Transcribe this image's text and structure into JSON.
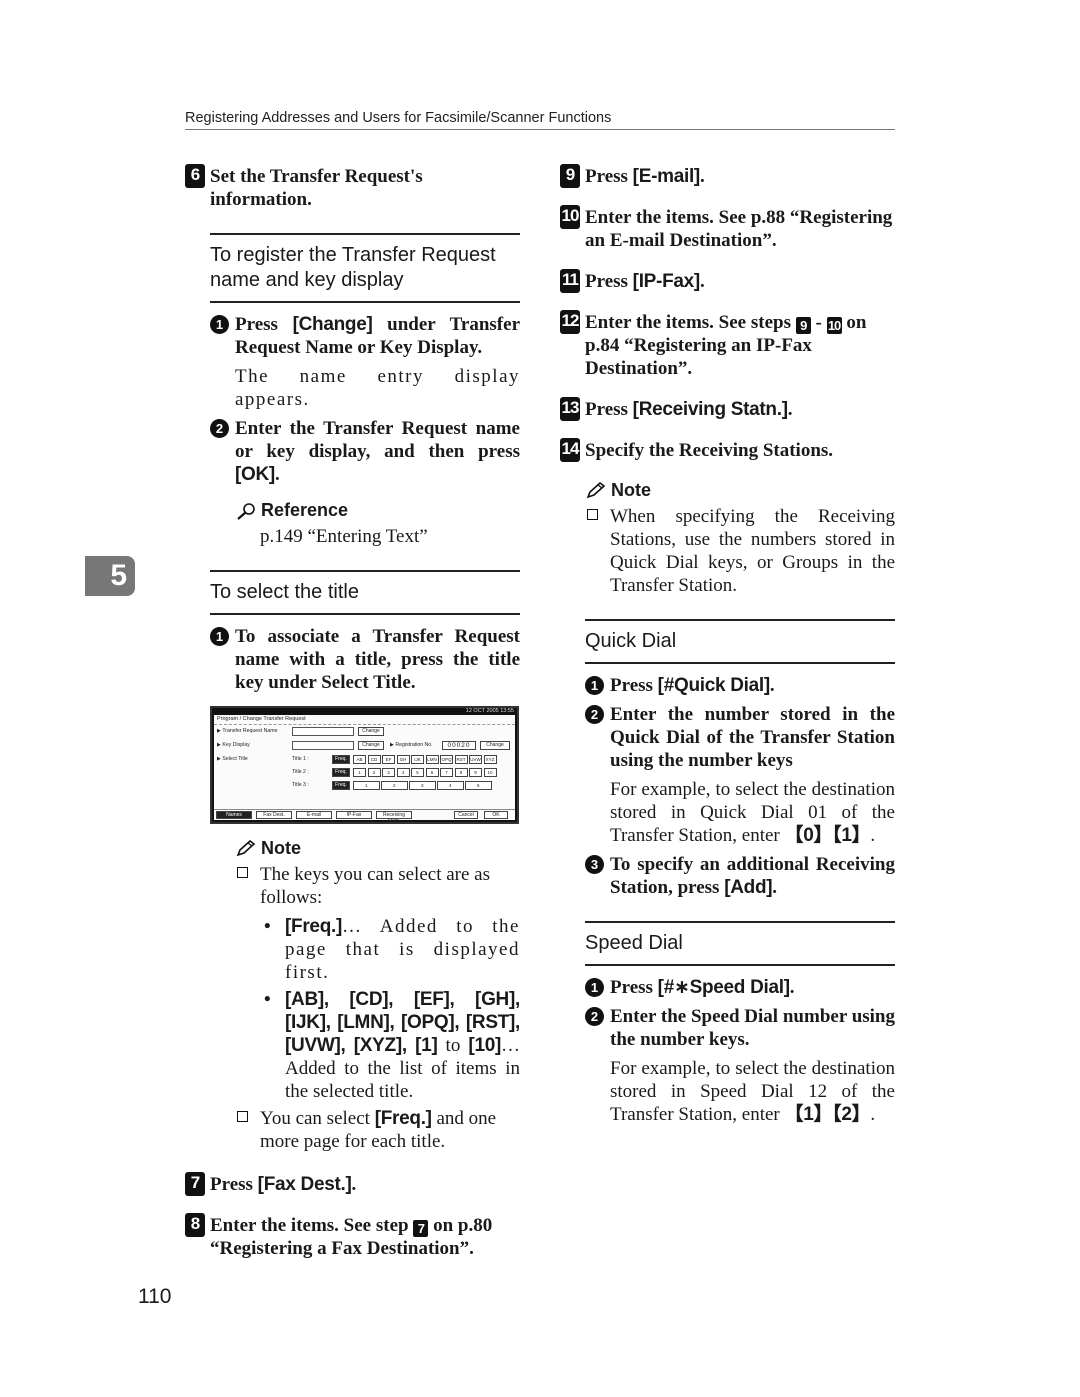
{
  "header": {
    "title": "Registering Addresses and Users for Facsimile/Scanner Functions"
  },
  "chapter_tab": "5",
  "page_number": "110",
  "left": {
    "step6": {
      "num": "6",
      "text": "Set the Transfer Request's information."
    },
    "section1": {
      "title": "To register the Transfer Request name and key display",
      "sub1": {
        "num": "1",
        "pre": "Press ",
        "key": "[Change]",
        "post": " under Transfer Request Name or Key Display.",
        "body": "The name entry display appears."
      },
      "sub2": {
        "num": "2",
        "pre": "Enter the Transfer Request name or key display, and then press ",
        "key": "[OK]",
        "post": "."
      },
      "reference": {
        "label": "Reference",
        "text": "p.149 “Entering Text”"
      }
    },
    "section2": {
      "title": "To select the title",
      "sub1": {
        "num": "1",
        "text": "To associate a Transfer Request name with a title, press the title key under Select Title."
      }
    },
    "screenshot": {
      "clock": "12 OCT  2005 13:55",
      "title": "Program / Change Transfer Request",
      "rows": {
        "transfer_request_name": "▶ Transfer Request Name",
        "key_display": "▶ Key Display",
        "select_title": "▶ Select Title"
      },
      "change_label": "Change",
      "registration_label": "▶ Registration No.",
      "registration_no": "00020",
      "title_labels": [
        "Title 1 :",
        "Title 2 :",
        "Title 3 :"
      ],
      "freq_label": "Freq.",
      "title1_keys": [
        "AB",
        "CD",
        "EF",
        "GH",
        "IJK",
        "LMN",
        "OPQ",
        "RST",
        "UVW",
        "XYZ"
      ],
      "title2_keys": [
        "1",
        "2",
        "3",
        "4",
        "5",
        "6",
        "7",
        "8",
        "9",
        "10"
      ],
      "title3_keys": [
        "1",
        "2",
        "3",
        "4",
        "5"
      ],
      "tabs": [
        "Names",
        "Fax Dest.",
        "E-mail",
        "IP-Fax",
        "Receiving Statn."
      ],
      "cancel": "Cancel",
      "ok": "OK"
    },
    "note": {
      "label": "Note",
      "item1": "The keys you can select are as follows:",
      "bullet1": {
        "key": "[Freq.]",
        "text": "… Added to the page that is displayed first."
      },
      "bullet2": {
        "keys": "[AB], [CD], [EF], [GH], [IJK], [LMN], [OPQ], [RST], [UVW], [XYZ], [1]",
        "mid": " to ",
        "key_end": "[10]",
        "text": "… Added to the list of items in the selected title."
      },
      "item2": {
        "pre": "You can select ",
        "key": "[Freq.]",
        "post": " and one more page for each title."
      }
    },
    "step7": {
      "num": "7",
      "pre": "Press ",
      "key": "[Fax Dest.]",
      "post": "."
    },
    "step8": {
      "num": "8",
      "pre": "Enter the items. See step ",
      "ref": "7",
      "post": " on p.80 “Registering a Fax Destination”."
    }
  },
  "right": {
    "step9": {
      "num": "9",
      "pre": "Press ",
      "key": "[E-mail]",
      "post": "."
    },
    "step10": {
      "num": "10",
      "text": "Enter the items. See p.88 “Registering an E-mail Destination”."
    },
    "step11": {
      "num": "11",
      "pre": "Press ",
      "key": "[IP-Fax]",
      "post": "."
    },
    "step12": {
      "num": "12",
      "pre": "Enter the items. See steps ",
      "ref1": "9",
      "dash": " - ",
      "ref2": "10",
      "post": " on p.84 “Registering an IP-Fax Destination”."
    },
    "step13": {
      "num": "13",
      "pre": "Press ",
      "key": "[Receiving Statn.]",
      "post": "."
    },
    "step14": {
      "num": "14",
      "text": "Specify the Receiving Stations."
    },
    "note": {
      "label": "Note",
      "item1": "When specifying the Receiving Stations, use the numbers stored in Quick Dial keys, or Groups in the Transfer Station."
    },
    "quick_dial": {
      "title": "Quick Dial",
      "sub1": {
        "num": "1",
        "pre": "Press ",
        "key": "[#Quick Dial]",
        "post": "."
      },
      "sub2": {
        "num": "2",
        "text": "Enter the number stored in the Quick Dial of the Transfer Station using the number keys",
        "body": "For example, to select the destination stored in Quick Dial 01 of the Transfer Station, enter ",
        "keys": "【0】【1】",
        "end": "."
      },
      "sub3": {
        "num": "3",
        "pre": "To specify an additional Receiving Station, press ",
        "key": "[Add]",
        "post": "."
      }
    },
    "speed_dial": {
      "title": "Speed Dial",
      "sub1": {
        "num": "1",
        "pre": "Press ",
        "key": "[#∗Speed Dial]",
        "post": "."
      },
      "sub2": {
        "num": "2",
        "text": "Enter the Speed Dial number using the number keys.",
        "body": "For example, to select the destination stored in Speed Dial 12 of the Transfer Station, enter ",
        "keys": "【1】【2】",
        "end": "."
      }
    }
  }
}
